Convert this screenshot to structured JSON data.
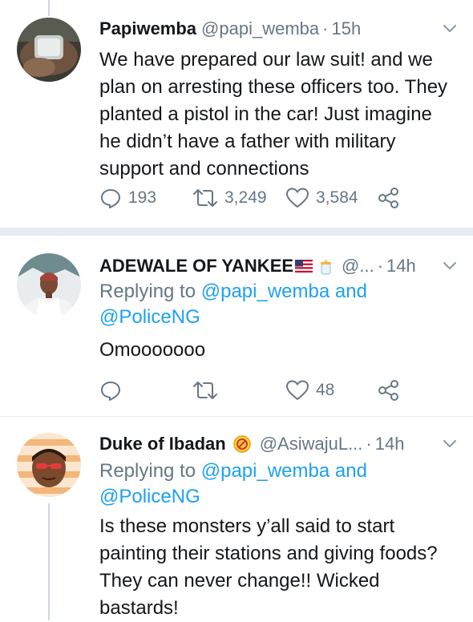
{
  "tweets": [
    {
      "name": "Papiwemba",
      "handle": "@papi_wemba",
      "dot": "·",
      "time": "15h",
      "text_lines": [
        "We have prepared our law suit! and we",
        "plan on arresting these officers too. They",
        "planted a pistol in the car! Just imagine",
        "he didn’t have a father with military",
        "support and connections"
      ],
      "replies": "193",
      "retweets": "3,249",
      "likes": "3,584"
    },
    {
      "name": "ADEWALE OF YANKEE",
      "name_emoji": [
        "us-flag-icon",
        "baby-bottle-icon"
      ],
      "handle": "@...",
      "dot": "·",
      "time": "14h",
      "replying_prefix": "Replying to ",
      "replying_user1": "@papi_wemba",
      "replying_and": " and",
      "replying_user2": "@PoliceNG",
      "text": "Omooooooo",
      "likes": "48"
    },
    {
      "name": "Duke of Ibadan",
      "name_emoji": [
        "no-entry-sign-icon"
      ],
      "handle": "@AsiwajuL...",
      "dot": "·",
      "time": "14h",
      "replying_prefix": "Replying to ",
      "replying_user1": "@papi_wemba",
      "replying_and": " and",
      "replying_user2": "@PoliceNG",
      "text_lines": [
        "Is these monsters y’all said to start",
        "painting their stations and giving foods?",
        "They can never change!! Wicked",
        "bastards!"
      ]
    }
  ],
  "colors": {
    "text": "#14171a",
    "muted": "#657786",
    "link": "#1da1f2",
    "separator": "#e6ecf0"
  }
}
